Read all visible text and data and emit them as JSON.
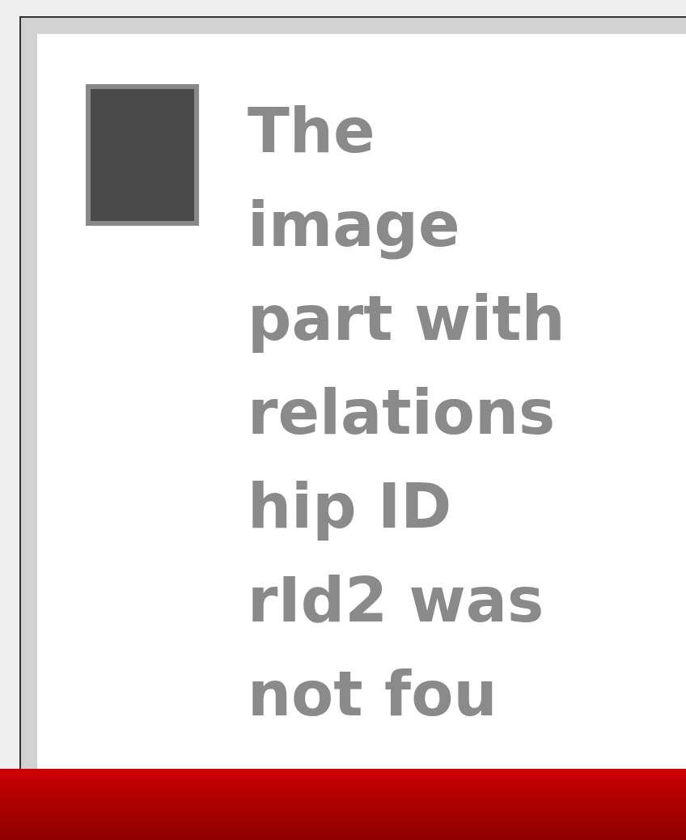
{
  "placeholder_image": {
    "message_lines": [
      "The",
      "image",
      "part with",
      "relations",
      "hip ID",
      "rId2 was",
      "not fou"
    ]
  }
}
